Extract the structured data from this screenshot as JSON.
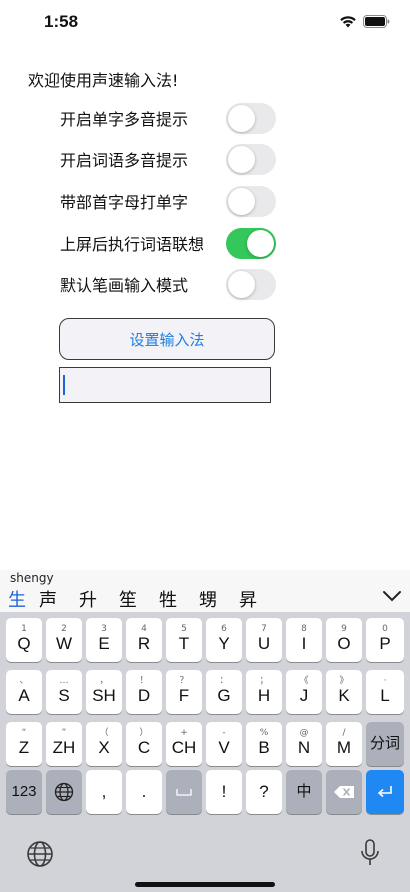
{
  "status_bar": {
    "time": "1:58"
  },
  "welcome_text": "欢迎使用声速输入法!",
  "settings": [
    {
      "label": "开启单字多音提示",
      "enabled": false
    },
    {
      "label": "开启词语多音提示",
      "enabled": false
    },
    {
      "label": "带部首字母打单字",
      "enabled": false
    },
    {
      "label": "上屏后执行词语联想",
      "enabled": true
    },
    {
      "label": "默认笔画输入模式",
      "enabled": false
    }
  ],
  "setup_button": {
    "label": "设置输入法"
  },
  "input_field": {
    "value": ""
  },
  "keyboard": {
    "pinyin": "shengy",
    "candidates": [
      "生",
      "声",
      "升",
      "笙",
      "牲",
      "甥",
      "昇"
    ],
    "row1": [
      {
        "hint": "1",
        "label": "Q"
      },
      {
        "hint": "2",
        "label": "W"
      },
      {
        "hint": "3",
        "label": "E"
      },
      {
        "hint": "4",
        "label": "R"
      },
      {
        "hint": "5",
        "label": "T"
      },
      {
        "hint": "6",
        "label": "Y"
      },
      {
        "hint": "7",
        "label": "U"
      },
      {
        "hint": "8",
        "label": "I"
      },
      {
        "hint": "9",
        "label": "O"
      },
      {
        "hint": "0",
        "label": "P"
      }
    ],
    "row2": [
      {
        "hint": "、",
        "label": "A"
      },
      {
        "hint": "…",
        "label": "S"
      },
      {
        "hint": "，",
        "label": "SH"
      },
      {
        "hint": "！",
        "label": "D"
      },
      {
        "hint": "？",
        "label": "F"
      },
      {
        "hint": "：",
        "label": "G"
      },
      {
        "hint": "；",
        "label": "H"
      },
      {
        "hint": "《",
        "label": "J"
      },
      {
        "hint": "》",
        "label": "K"
      },
      {
        "hint": "·",
        "label": "L"
      }
    ],
    "row3": [
      {
        "hint": "“",
        "label": "Z"
      },
      {
        "hint": "”",
        "label": "ZH"
      },
      {
        "hint": "（",
        "label": "X"
      },
      {
        "hint": "）",
        "label": "C"
      },
      {
        "hint": "+",
        "label": "CH"
      },
      {
        "hint": "-",
        "label": "V"
      },
      {
        "hint": "%",
        "label": "B"
      },
      {
        "hint": "@",
        "label": "N"
      },
      {
        "hint": "/",
        "label": "M"
      }
    ],
    "fenci_label": "分词",
    "row4": {
      "numbers": "123",
      "comma": ",",
      "period": ".",
      "exclaim": "!",
      "question": "?",
      "zhong": "中"
    }
  }
}
